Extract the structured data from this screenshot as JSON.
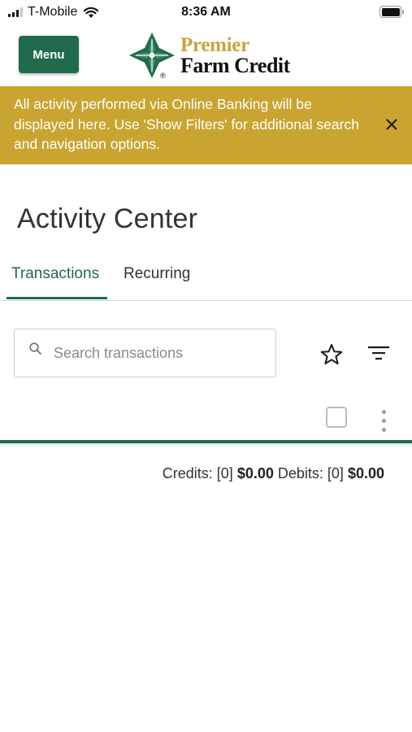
{
  "status_bar": {
    "carrier": "T-Mobile",
    "time": "8:36 AM",
    "signal_bars_active": 3,
    "signal_bars_total": 4,
    "icons": [
      "signal-bars-icon",
      "wifi-icon",
      "battery-icon"
    ]
  },
  "header": {
    "menu_label": "Menu",
    "logo_line1": "Premier",
    "logo_line2": "Farm Credit",
    "logo_registered": "®"
  },
  "banner": {
    "message": "All activity performed via Online Banking will be displayed here. Use 'Show Filters' for additional search and navigation options.",
    "close_icon": "close-icon"
  },
  "page": {
    "title": "Activity Center"
  },
  "tabs": [
    {
      "label": "Transactions",
      "active": true
    },
    {
      "label": "Recurring",
      "active": false
    }
  ],
  "search": {
    "placeholder": "Search transactions",
    "value": "",
    "icons": [
      "search-icon",
      "star-icon",
      "filter-icon"
    ]
  },
  "list_controls": {
    "select_all_checked": false,
    "more_icon": "kebab-menu-icon"
  },
  "totals": {
    "credits_label": "Credits:",
    "credits_count": "[0]",
    "credits_amount": "$0.00",
    "debits_label": "Debits:",
    "debits_count": "[0]",
    "debits_amount": "$0.00"
  },
  "colors": {
    "brand_green": "#1f6b4b",
    "banner_gold": "#c9a430",
    "logo_gold": "#c9a43e"
  }
}
